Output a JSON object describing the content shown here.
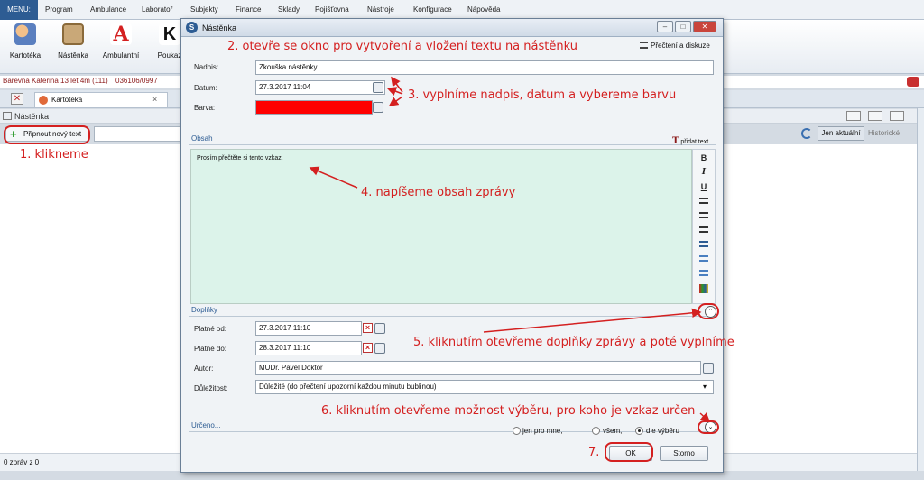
{
  "menubar": {
    "menu_label": "MENU:",
    "items": [
      "Program",
      "Ambulance",
      "Laboratoř",
      "Subjekty",
      "Finance",
      "Sklady",
      "Pojišťovna",
      "Nástroje",
      "Konfigurace",
      "Nápověda"
    ]
  },
  "ribbon": {
    "buttons": [
      {
        "label": "Kartotéka",
        "icon": "people-icon"
      },
      {
        "label": "Nástěnka",
        "icon": "board-icon"
      },
      {
        "label": "Ambulantní",
        "icon": "letter-a-icon"
      },
      {
        "label": "Poukaz",
        "icon": "letter-k-icon"
      }
    ]
  },
  "patient": {
    "name": "Barevná Kateřina 13 let 4m (111)",
    "id": "036106/0997"
  },
  "tabs": [
    {
      "label": "Kartotéka"
    }
  ],
  "panel": {
    "title": "Nástěnka",
    "add_button": "Připnout nový text",
    "toggle_current": "Jen aktuální",
    "toggle_history": "Historické",
    "status": "0 zpráv z 0"
  },
  "dialog": {
    "title": "Nástěnka",
    "read_button": "Přečtení a diskuze",
    "fields": {
      "nadpis_label": "Nadpis:",
      "nadpis_value": "Zkouška nástěnky",
      "datum_label": "Datum:",
      "datum_value": "27.3.2017 11:04",
      "barva_label": "Barva:",
      "barva_color": "#ff0000"
    },
    "content_section": "Obsah",
    "add_text": "přidat text",
    "content_text": "Prosím přečtěte si tento vzkaz.",
    "extras_section": "Doplňky",
    "extras": {
      "platne_od_label": "Platné od:",
      "platne_od_value": "27.3.2017 11:10",
      "platne_do_label": "Platné do:",
      "platne_do_value": "28.3.2017 11:10",
      "autor_label": "Autor:",
      "autor_value": "MUDr. Pavel Doktor",
      "dulezitost_label": "Důležitost:",
      "dulezitost_value": "Důležité (do přečtení upozorní každou minutu bublinou)"
    },
    "urceno_section": "Určeno...",
    "radio": {
      "only_me": "jen pro mne,",
      "all": "všem,",
      "selection": "dle výběru",
      "selected": "selection"
    },
    "ok_button": "OK",
    "cancel_button": "Storno"
  },
  "annotations": {
    "a1": "1. klikneme",
    "a2": "2. otevře se okno pro vytvoření a vložení textu na nástěnku",
    "a3": "3. vyplníme nadpis, datum a vybereme barvu",
    "a4": "4. napíšeme obsah zprávy",
    "a5": "5. kliknutím otevřeme doplňky zprávy a poté vyplníme",
    "a6": "6. kliknutím otevřeme možnost výběru, pro koho je vzkaz určen",
    "a7": "7."
  },
  "colors": {
    "accent": "#2d5c93",
    "annotation": "#d42020",
    "editor_bg": "#dcf3ea"
  }
}
